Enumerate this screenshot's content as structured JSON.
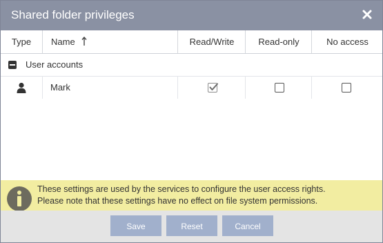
{
  "dialog": {
    "title": "Shared folder privileges"
  },
  "grid": {
    "columns": {
      "type": "Type",
      "name": "Name",
      "read_write": "Read/Write",
      "read_only": "Read-only",
      "no_access": "No access"
    },
    "sort": {
      "column": "Name",
      "direction": "ascending"
    },
    "group": {
      "label": "User accounts",
      "expanded": true
    },
    "rows": [
      {
        "type_icon": "user-icon",
        "name": "Mark",
        "read_write": true,
        "read_only": false,
        "no_access": false
      }
    ]
  },
  "info": {
    "icon": "info-icon",
    "line1": "These settings are used by the services to configure the user access rights.",
    "line2": "Please note that these settings have no effect on file system permissions."
  },
  "buttons": {
    "save": "Save",
    "reset": "Reset",
    "cancel": "Cancel"
  },
  "colors": {
    "titlebar": "#8a91a3",
    "info_bg": "#f2eda1",
    "button_bg": "#a1b0cc",
    "footer_bg": "#e4e4e4"
  }
}
